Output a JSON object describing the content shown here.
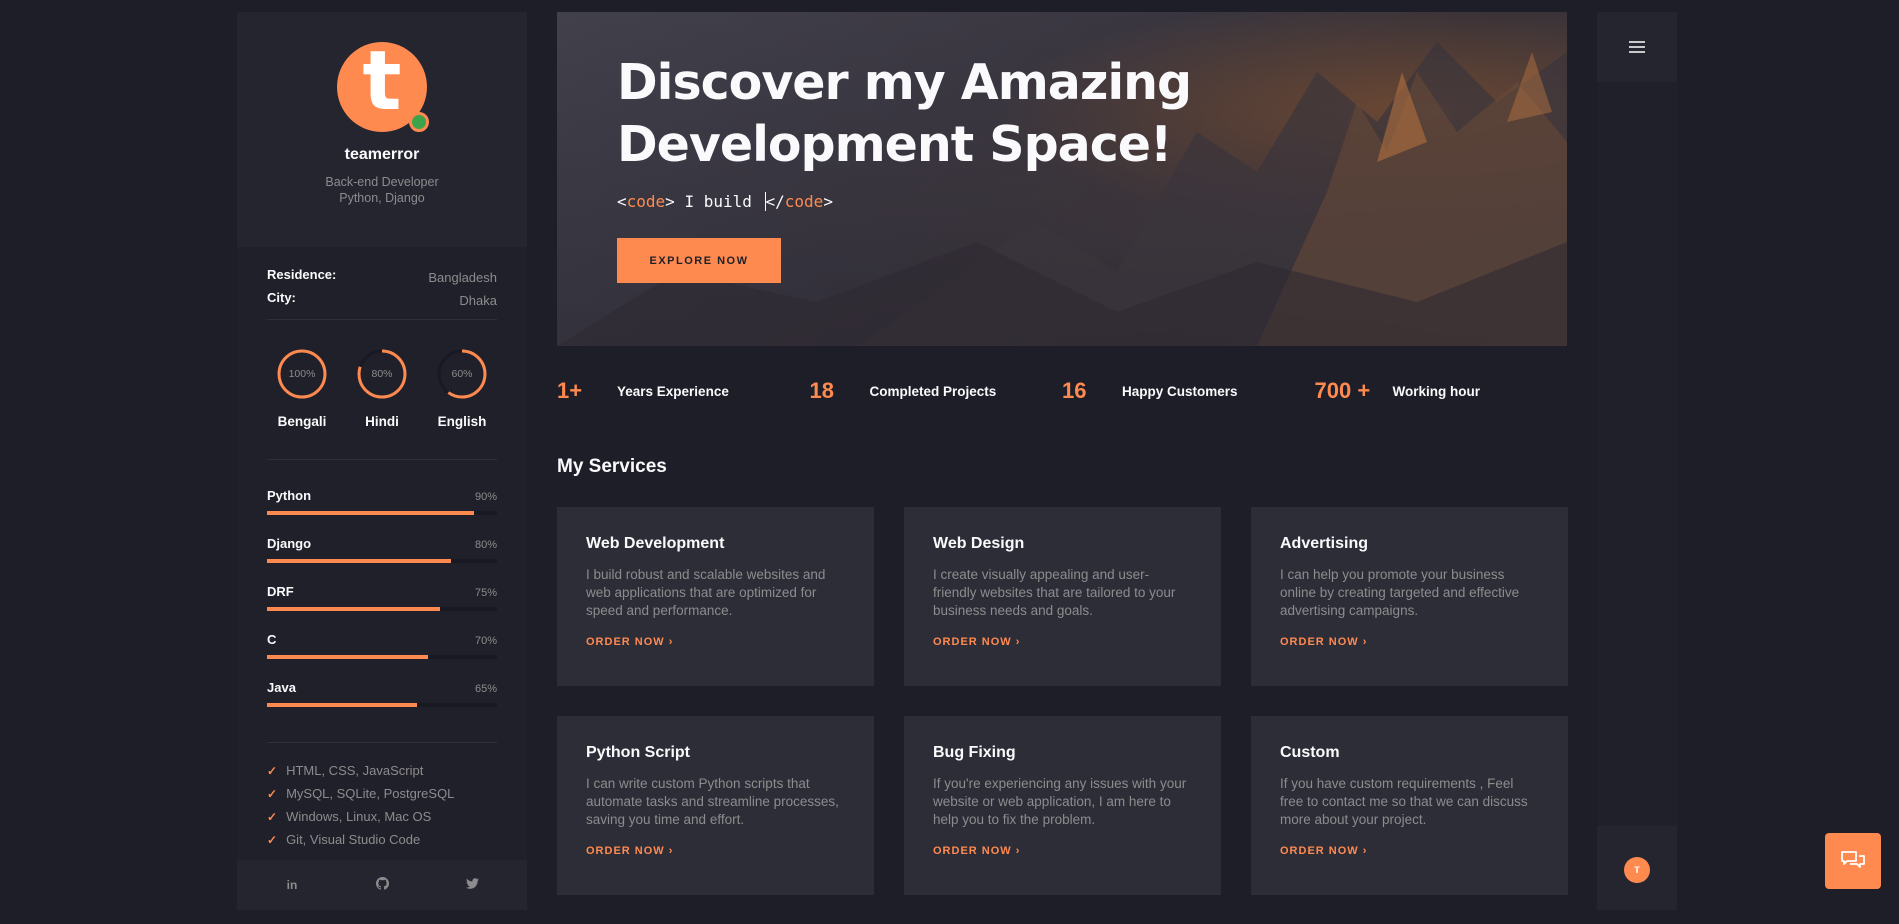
{
  "profile": {
    "avatar_letter": "t",
    "name": "teamerror",
    "role_line1": "Back-end Developer",
    "role_line2": "Python, Django"
  },
  "info": [
    {
      "key": "Residence:",
      "value": "Bangladesh"
    },
    {
      "key": "City:",
      "value": "Dhaka"
    }
  ],
  "languages": [
    {
      "name": "Bengali",
      "percent": "100%",
      "level": 1.0
    },
    {
      "name": "Hindi",
      "percent": "80%",
      "level": 0.8
    },
    {
      "name": "English",
      "percent": "60%",
      "level": 0.6
    }
  ],
  "skills": [
    {
      "name": "Python",
      "percent": "90%",
      "level": 0.9
    },
    {
      "name": "Django",
      "percent": "80%",
      "level": 0.8
    },
    {
      "name": "DRF",
      "percent": "75%",
      "level": 0.75
    },
    {
      "name": "C",
      "percent": "70%",
      "level": 0.7
    },
    {
      "name": "Java",
      "percent": "65%",
      "level": 0.65
    }
  ],
  "knowledge": [
    "HTML, CSS, JavaScript",
    "MySQL, SQLite, PostgreSQL",
    "Windows, Linux, Mac OS",
    "Git, Visual Studio Code"
  ],
  "socials": {
    "linkedin": "in",
    "github_icon": "github-icon",
    "twitter_icon": "twitter-icon"
  },
  "hero": {
    "title_line1": "Discover my Amazing",
    "title_line2": "Development Space!",
    "code_open_lt": "<",
    "code_open_tag": "code",
    "code_open_gt": ">",
    "code_text": " I build ",
    "code_close_lt": "</",
    "code_close_tag": "code",
    "code_close_gt": ">",
    "button": "EXPLORE NOW"
  },
  "counters": [
    {
      "num": "1+",
      "label": "Years Experience"
    },
    {
      "num": "18",
      "label": "Completed Projects"
    },
    {
      "num": "16",
      "label": "Happy Customers"
    },
    {
      "num": "700 +",
      "label": "Working hour"
    }
  ],
  "services_title": "My Services",
  "services": [
    {
      "title": "Web Development",
      "desc": "I build robust and scalable websites and web applications that are optimized for speed and performance.",
      "link": "ORDER NOW"
    },
    {
      "title": "Web Design",
      "desc": "I create visually appealing and user-friendly websites that are tailored to your business needs and goals.",
      "link": "ORDER NOW"
    },
    {
      "title": "Advertising",
      "desc": "I can help you promote your business online by creating targeted and effective advertising campaigns.",
      "link": "ORDER NOW"
    },
    {
      "title": "Python Script",
      "desc": "I can write custom Python scripts that automate tasks and streamline processes, saving you time and effort.",
      "link": "ORDER NOW"
    },
    {
      "title": "Bug Fixing",
      "desc": "If you're experiencing any issues with your website or web application, I am here to help you to fix the problem.",
      "link": "ORDER NOW"
    },
    {
      "title": "Custom",
      "desc": "If you have custom requirements , Feel free to contact me so that we can discuss more about your project.",
      "link": "ORDER NOW"
    }
  ],
  "rail": {
    "avatar_letter": "T"
  },
  "colors": {
    "accent": "#ff8a4f",
    "background": "#1e1e28",
    "panel": "#20202a",
    "card": "#2d2d38",
    "online": "#3ea34b"
  }
}
